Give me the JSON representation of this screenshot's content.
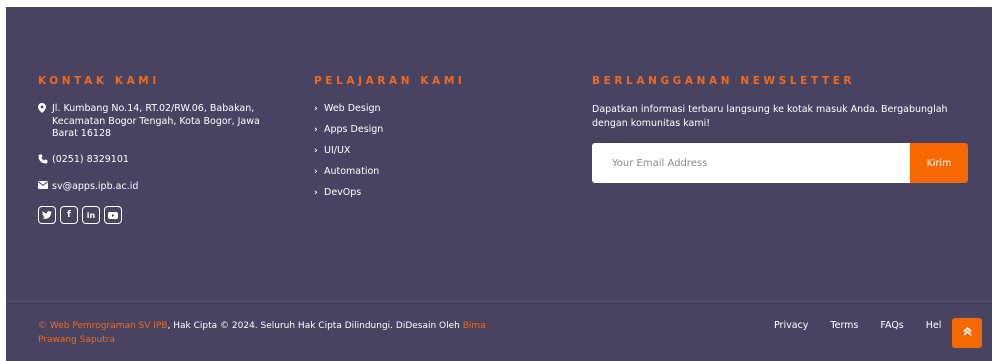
{
  "contact": {
    "heading": "KONTAK KAMI",
    "address": "Jl. Kumbang No.14, RT.02/RW.06, Babakan, Kecamatan Bogor Tengah, Kota Bogor, Jawa Barat 16128",
    "phone": "(0251) 8329101",
    "email": "sv@apps.ipb.ac.id",
    "socials": {
      "twitter_icon": "twitter-icon",
      "facebook_icon": "facebook-icon",
      "linkedin_icon": "linkedin-icon",
      "youtube_icon": "youtube-icon"
    }
  },
  "courses": {
    "heading": "PELAJARAN KAMI",
    "items": [
      "Web Design",
      "Apps Design",
      "UI/UX",
      "Automation",
      "DevOps"
    ]
  },
  "newsletter": {
    "heading": "BERLANGGANAN NEWSLETTER",
    "text": "Dapatkan informasi terbaru langsung ke kotak masuk Anda. Bergabunglah dengan komunitas kami!",
    "placeholder": "Your Email Address",
    "button": "Kirim"
  },
  "footer_bottom": {
    "copyright_symbol": "©",
    "site_link": "Web Pemrograman SV IPB",
    "copyright_text": ", Hak Cipta © 2024. Seluruh Hak Cipta Dilindungi. DiDesain Oleh ",
    "designer_link": "Bima Prawang Saputra",
    "links": [
      "Privacy",
      "Terms",
      "FAQs",
      "Hel"
    ]
  },
  "colors": {
    "background": "#474360",
    "accent": "#f3691d",
    "button": "#f86800"
  }
}
